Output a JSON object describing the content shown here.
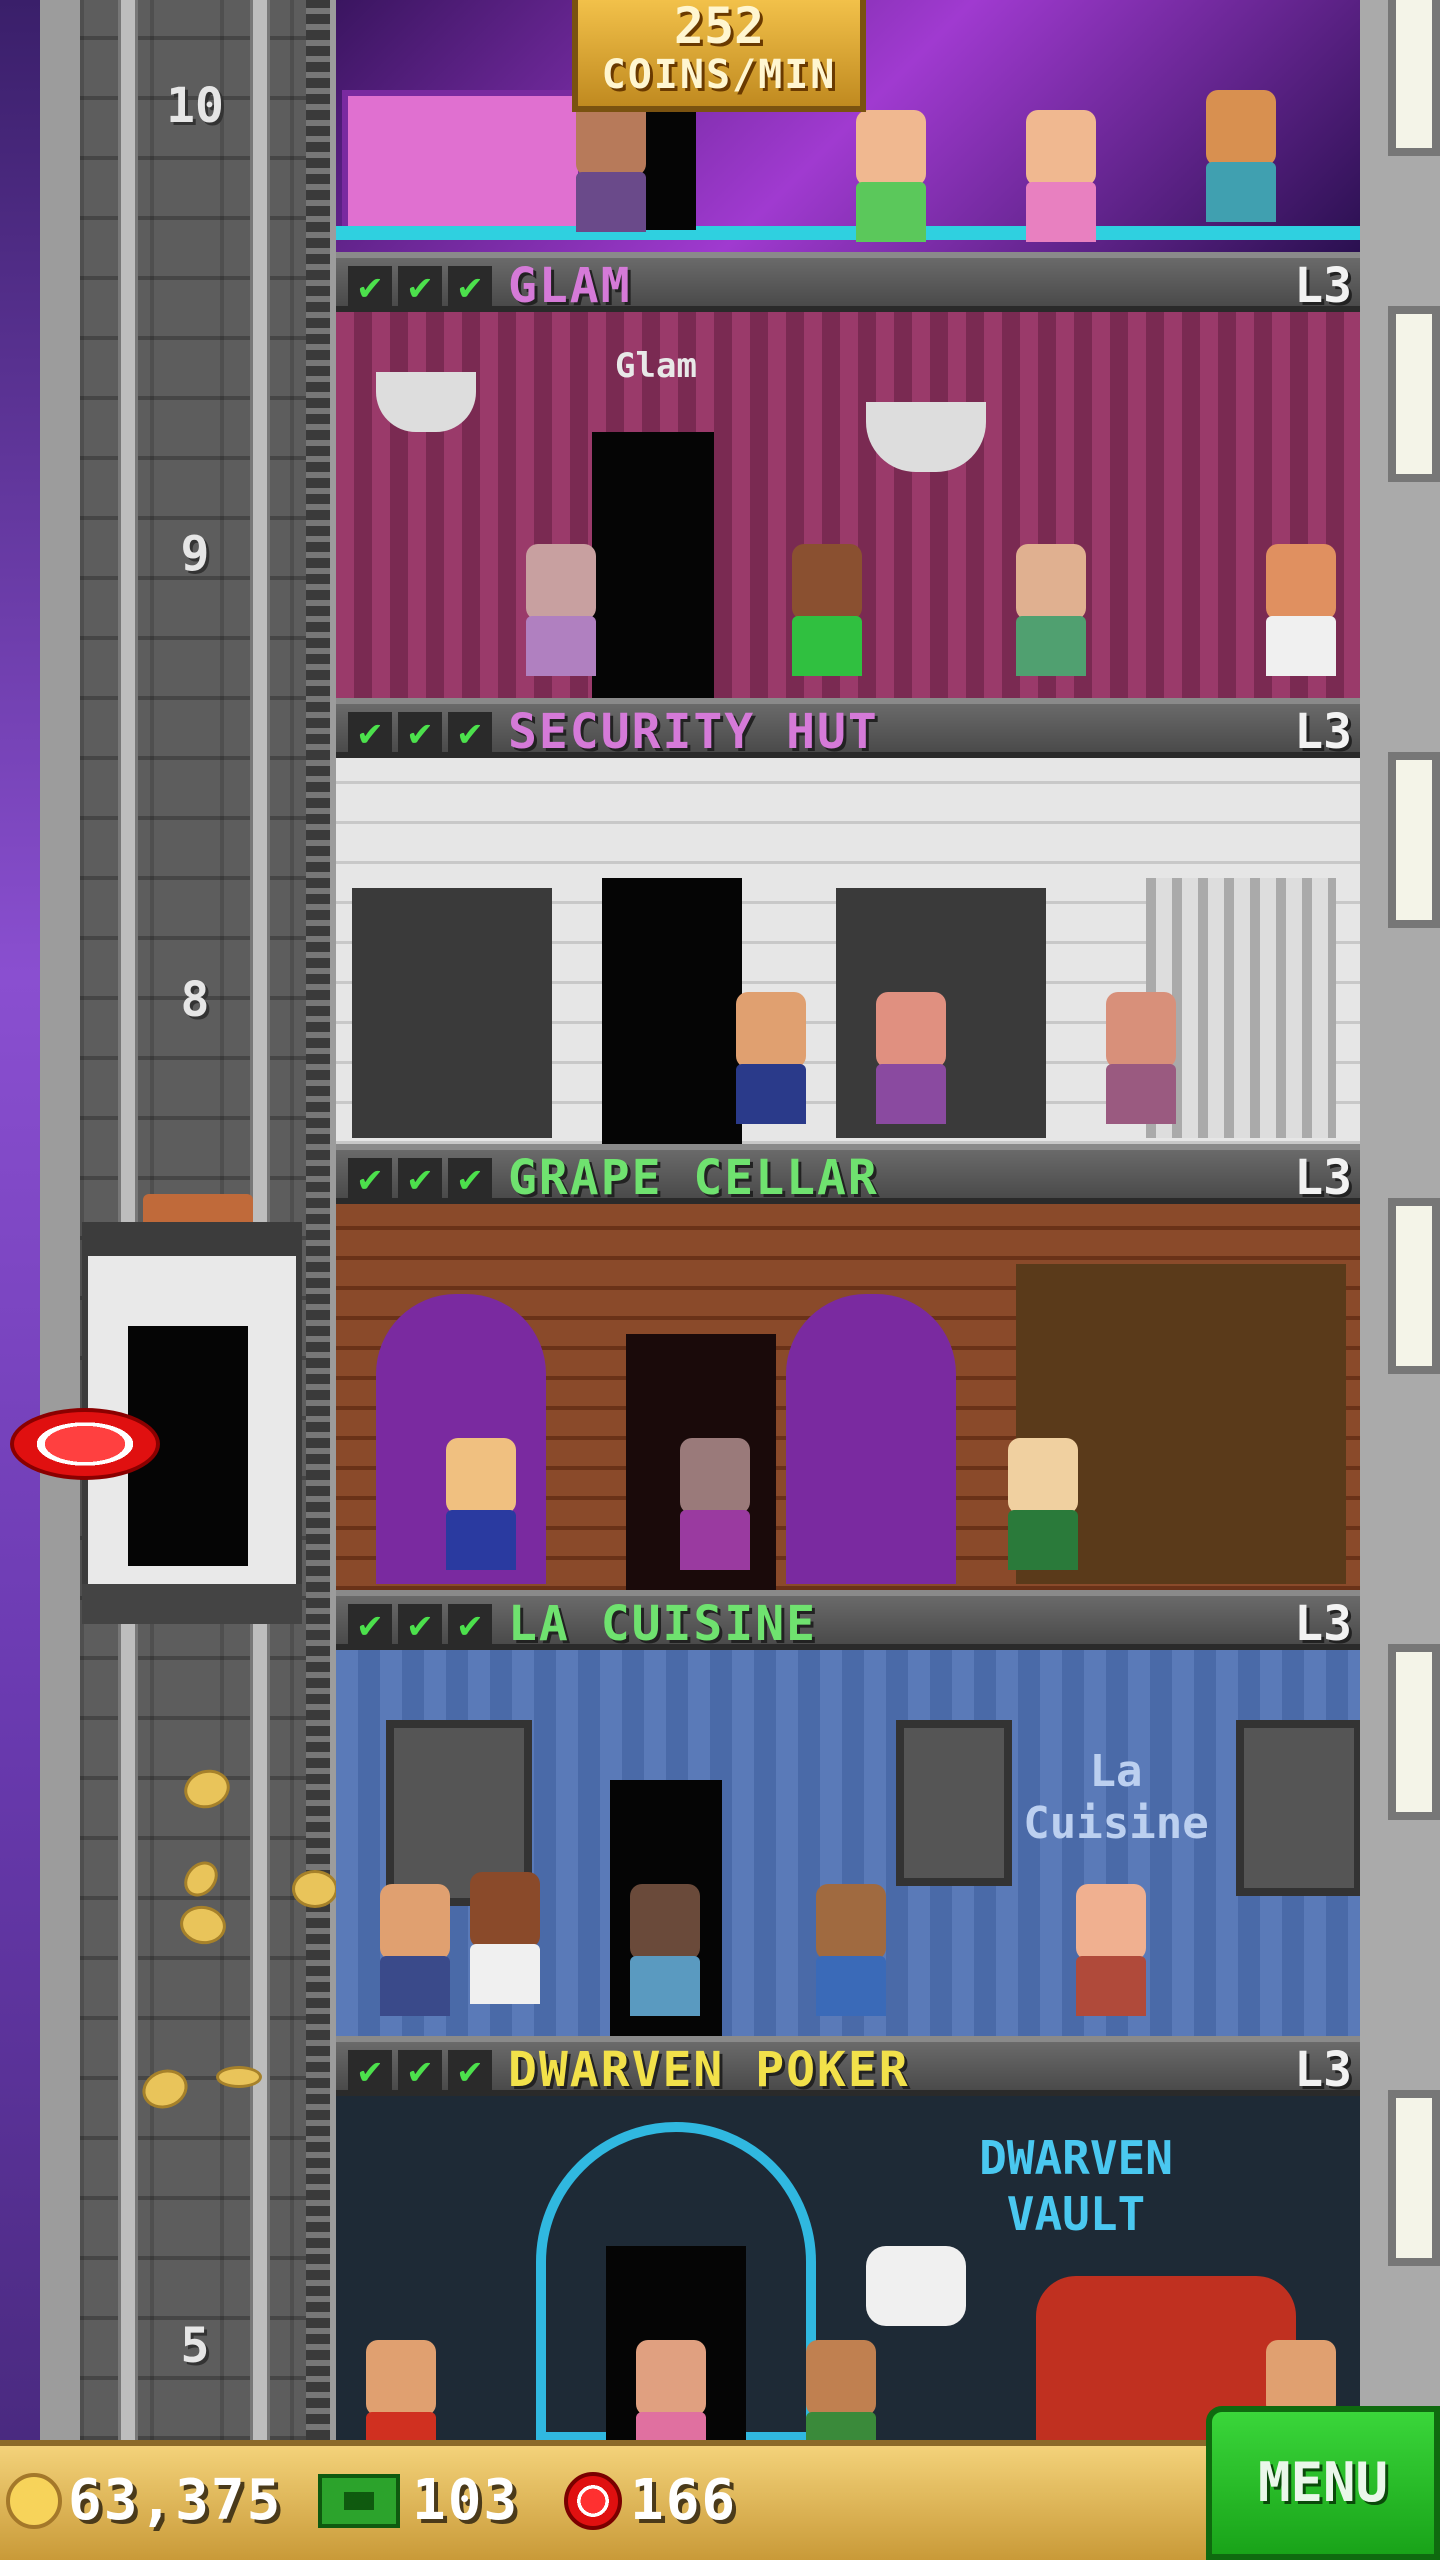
{
  "shaft": {
    "floor_labels": [
      "10",
      "9",
      "8",
      "5"
    ]
  },
  "top_banner": {
    "value": "252",
    "label": "COINS/MIN"
  },
  "floors": [
    {
      "name": "GLAM",
      "level": "L3",
      "name_color": "#d57ad8",
      "checks": [
        "✔",
        "✔",
        "✔"
      ],
      "sign": "Glam"
    },
    {
      "name": "SECURITY HUT",
      "level": "L3",
      "name_color": "#d57ad8",
      "checks": [
        "✔",
        "✔",
        "✔"
      ]
    },
    {
      "name": "GRAPE CELLAR",
      "level": "L3",
      "name_color": "#6fe26f",
      "checks": [
        "✔",
        "✔",
        "✔"
      ]
    },
    {
      "name": "LA CUISINE",
      "level": "L3",
      "name_color": "#6fe26f",
      "checks": [
        "✔",
        "✔",
        "✔"
      ],
      "sign": "La Cuisine"
    },
    {
      "name": "DWARVEN POKER",
      "level": "L3",
      "name_color": "#f2e14a",
      "checks": [
        "✔",
        "✔",
        "✔"
      ],
      "sign": "DWARVEN VAULT"
    }
  ],
  "bottom_bar": {
    "coins": "63,375",
    "bux": "103",
    "chips": "166",
    "menu_label": "MENU"
  }
}
